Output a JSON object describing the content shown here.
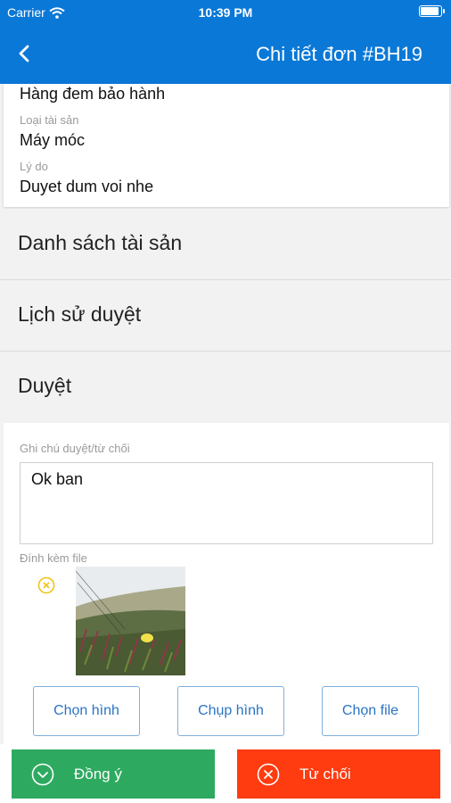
{
  "status_bar": {
    "carrier": "Carrier",
    "time": "10:39 PM"
  },
  "header": {
    "title": "Chi tiết đơn #BH19"
  },
  "info": {
    "partial_value": "Hàng đem bảo hành",
    "asset_type_label": "Loại tài sản",
    "asset_type_value": "Máy móc",
    "reason_label": "Lý do",
    "reason_value": "Duyet dum voi nhe"
  },
  "sections": {
    "asset_list": "Danh sách tài sản",
    "approval_history": "Lịch sử duyệt",
    "approve": "Duyệt"
  },
  "approve_form": {
    "note_label": "Ghi chú duyệt/từ chối",
    "note_value": "Ok ban",
    "attach_label": "Đính kèm file",
    "choose_image": "Chọn hình",
    "take_photo": "Chụp hình",
    "choose_file": "Chọn file"
  },
  "actions": {
    "accept": "Đồng ý",
    "reject": "Từ chối"
  },
  "colors": {
    "primary": "#0a78d7",
    "accept": "#2eaa60",
    "reject": "#ff3b10",
    "remove_icon": "#f0c419"
  }
}
